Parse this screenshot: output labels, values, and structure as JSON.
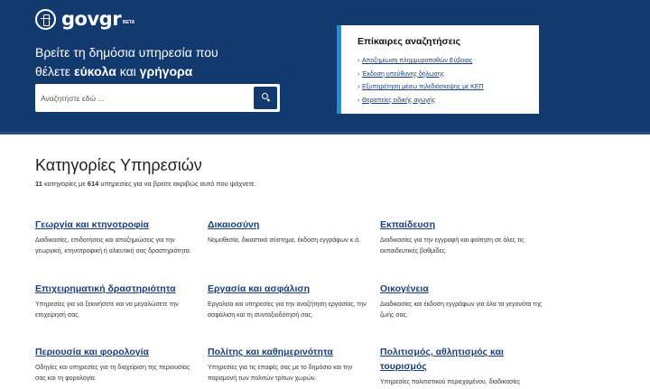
{
  "header": {
    "logo_word_gov": "gov",
    "logo_word_gr": "gr",
    "logo_beta": "BETA",
    "logo_icon": "greek-emblem-icon",
    "hero_line1": "Βρείτε τη δημόσια υπηρεσία που",
    "hero_line2_pre": "θέλετε ",
    "hero_line2_bold1": "εύκολα",
    "hero_line2_mid": " και ",
    "hero_line2_bold2": "γρήγορα",
    "search_placeholder": "Αναζητήστε εδώ ...",
    "search_icon": "search-icon"
  },
  "trending": {
    "title": "Επίκαιρες αναζητήσεις",
    "items": [
      "Αποζημίωση πλημμυροπαθών Εύβοιας",
      "Έκδοση υπεύθυνης δήλωσης",
      "Εξυπηρέτηση μέσω τηλεδιάσκεψης με ΚΕΠ",
      "Θεραπείες ειδικής αγωγής"
    ]
  },
  "categories": {
    "title": "Κατηγορίες Υπηρεσιών",
    "count_categories": "11",
    "sub_mid": " κατηγορίες με ",
    "count_services": "614",
    "sub_end": " υπηρεσίες για να βρείτε ακριβώς αυτό που ψάχνετε.",
    "items": [
      {
        "title": "Γεωργία και κτηνοτροφία",
        "desc": "Διαδικασίες, επιδοτήσεις και αποζημιώσεις για την γεωργική, κτηνοτροφική ή αλιευτική σας δραστηριότητα."
      },
      {
        "title": "Δικαιοσύνη",
        "desc": "Νομοθεσία, δικαστικό σύστημα, έκδοση εγγράφων κ.ά."
      },
      {
        "title": "Εκπαίδευση",
        "desc": "Διαδικασίες για την εγγραφή και φοίτηση σε όλες τις εκπαιδευτικές βαθμίδες."
      },
      {
        "title": "Επιχειρηματική δραστηριότητα",
        "desc": "Υπηρεσίες για να ξεκινήσετε και να μεγαλώσετε την επιχείρησή σας."
      },
      {
        "title": "Εργασία και ασφάλιση",
        "desc": "Εργαλεία και υπηρεσίες για την αναζήτηση εργασίας, την ασφάλιση και τη συνταξιοδότησή σας."
      },
      {
        "title": "Οικογένεια",
        "desc": "Διαδικασίες και έκδοση εγγράφων για όλα τα γεγονότα της ζωής σας."
      },
      {
        "title": "Περιουσία και φορολογία",
        "desc": "Οδηγίες και υπηρεσίες για τη διαχείριση της περιουσίας σας και τη φορολογία."
      },
      {
        "title": "Πολίτης και καθημερινότητα",
        "desc": "Υπηρεσίες για τις επαφές σας με το δημόσιο και την παραμονή των πολιτών τρίτων χωρών."
      },
      {
        "title": "Πολιτισμός, αθλητισμός και τουρισμός",
        "desc": "Υπηρεσίες πολιτιστικού περιεχομένου, διαδικασίες"
      }
    ]
  }
}
